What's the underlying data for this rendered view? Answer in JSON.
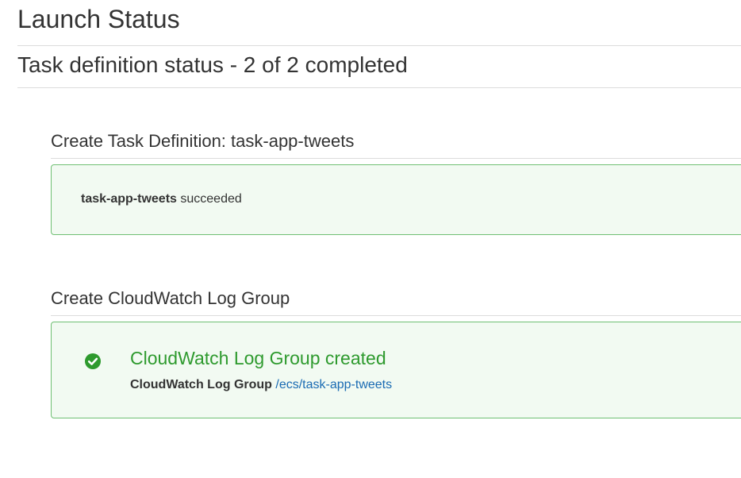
{
  "page": {
    "title": "Launch Status",
    "subtitle": "Task definition status - 2 of 2 completed"
  },
  "sections": [
    {
      "heading": "Create Task Definition: task-app-tweets",
      "status": {
        "name": "task-app-tweets",
        "text": "succeeded"
      }
    },
    {
      "heading": "Create CloudWatch Log Group",
      "status": {
        "icon": "check-circle-icon",
        "title": "CloudWatch Log Group created",
        "detail_label": "CloudWatch Log Group",
        "detail_link": "/ecs/task-app-tweets"
      }
    }
  ],
  "colors": {
    "success_green": "#2e9a2e",
    "box_border": "#6fbf73",
    "box_bg": "#f2faf2",
    "link_blue": "#1a6bb3"
  }
}
